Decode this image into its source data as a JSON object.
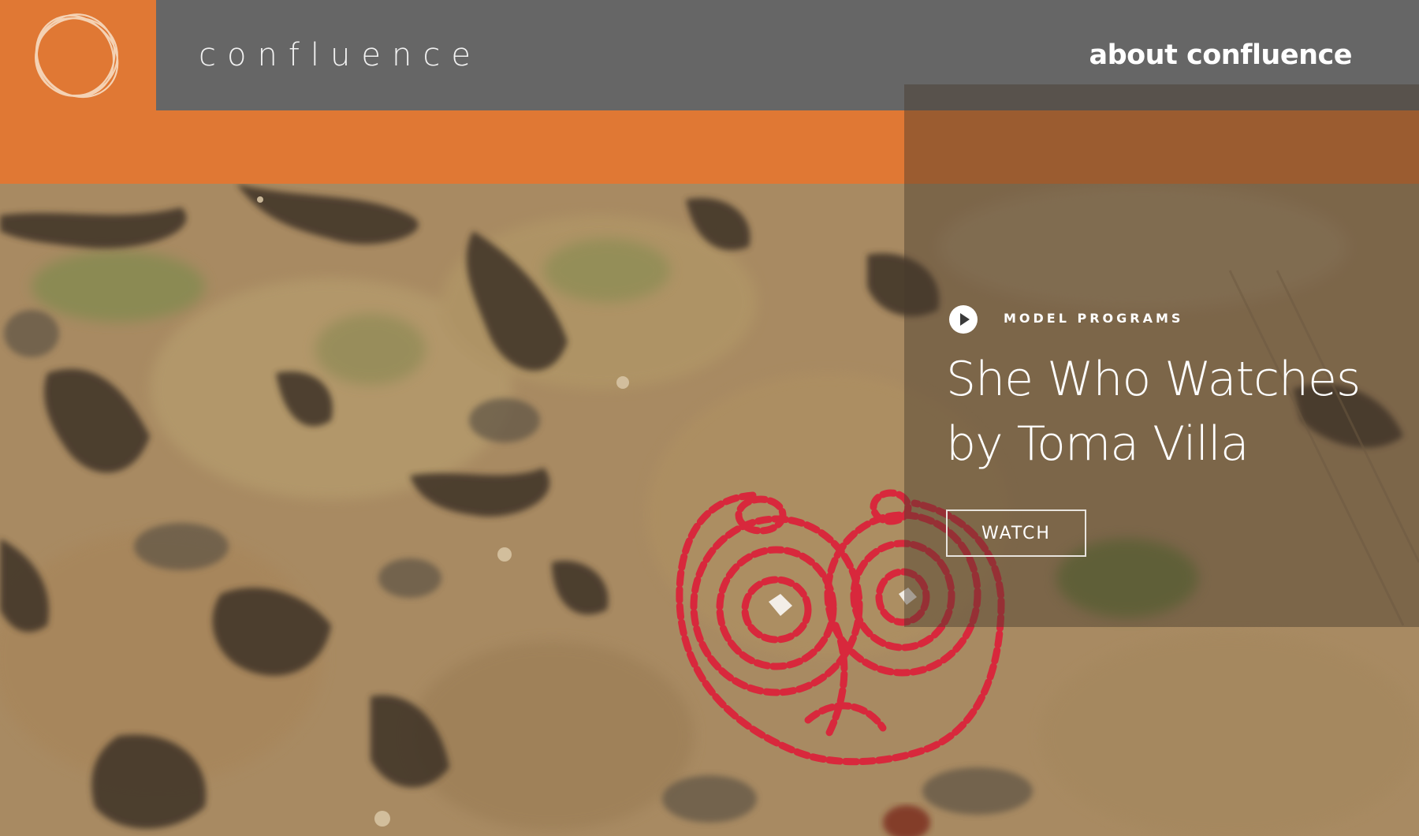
{
  "header": {
    "brand": "confluence",
    "about_link": "about confluence"
  },
  "feature": {
    "category": "MODEL PROGRAMS",
    "title_line1": "She Who Watches",
    "title_line2": "by Toma Villa",
    "watch_label": "WATCH"
  },
  "colors": {
    "brand_orange": "#e07834",
    "topbar_gray": "#666666",
    "figure_red": "#d8283c"
  },
  "icons": {
    "logo": "circular-rings-logo",
    "play": "play-circle-icon"
  }
}
